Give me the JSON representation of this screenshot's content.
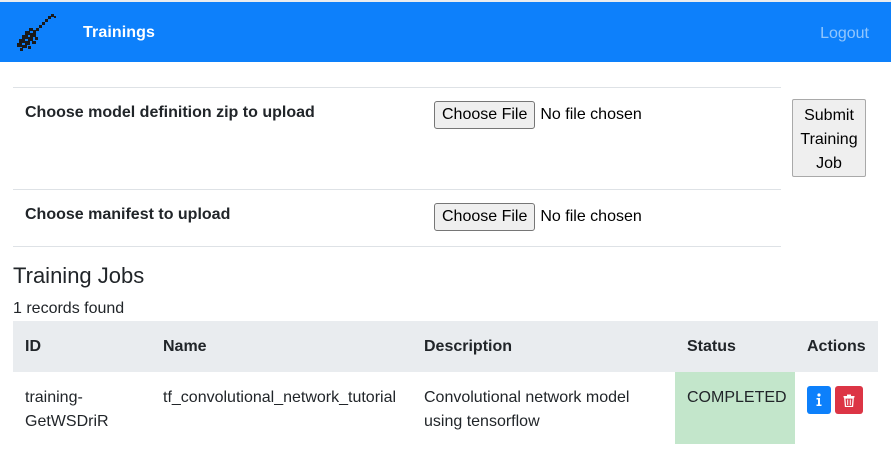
{
  "navbar": {
    "title": "Trainings",
    "logout": "Logout",
    "logo_icon": "guitar-logo-icon"
  },
  "upload": {
    "model_label": "Choose model definition zip to upload",
    "manifest_label": "Choose manifest to upload",
    "choose_file_label": "Choose File",
    "no_file_text": "No file chosen",
    "submit_lines": [
      "Submit",
      "Training",
      "Job"
    ]
  },
  "jobs": {
    "title": "Training Jobs",
    "records_text": "1 records found",
    "columns": [
      "ID",
      "Name",
      "Description",
      "Status",
      "Actions"
    ],
    "rows": [
      {
        "id_lines": [
          "training-",
          "GetWSDriR"
        ],
        "name": "tf_convolutional_network_tutorial",
        "description_lines": [
          "Convolutional network model",
          "using tensorflow"
        ],
        "status": "COMPLETED",
        "actions": [
          "info-icon",
          "trash-icon"
        ]
      }
    ]
  },
  "colors": {
    "navbar": "#0d80fb",
    "status_completed": "#c3e6cb",
    "info_button": "#0d80fb",
    "delete_button": "#dc3545",
    "table_header": "#e9ecef"
  }
}
